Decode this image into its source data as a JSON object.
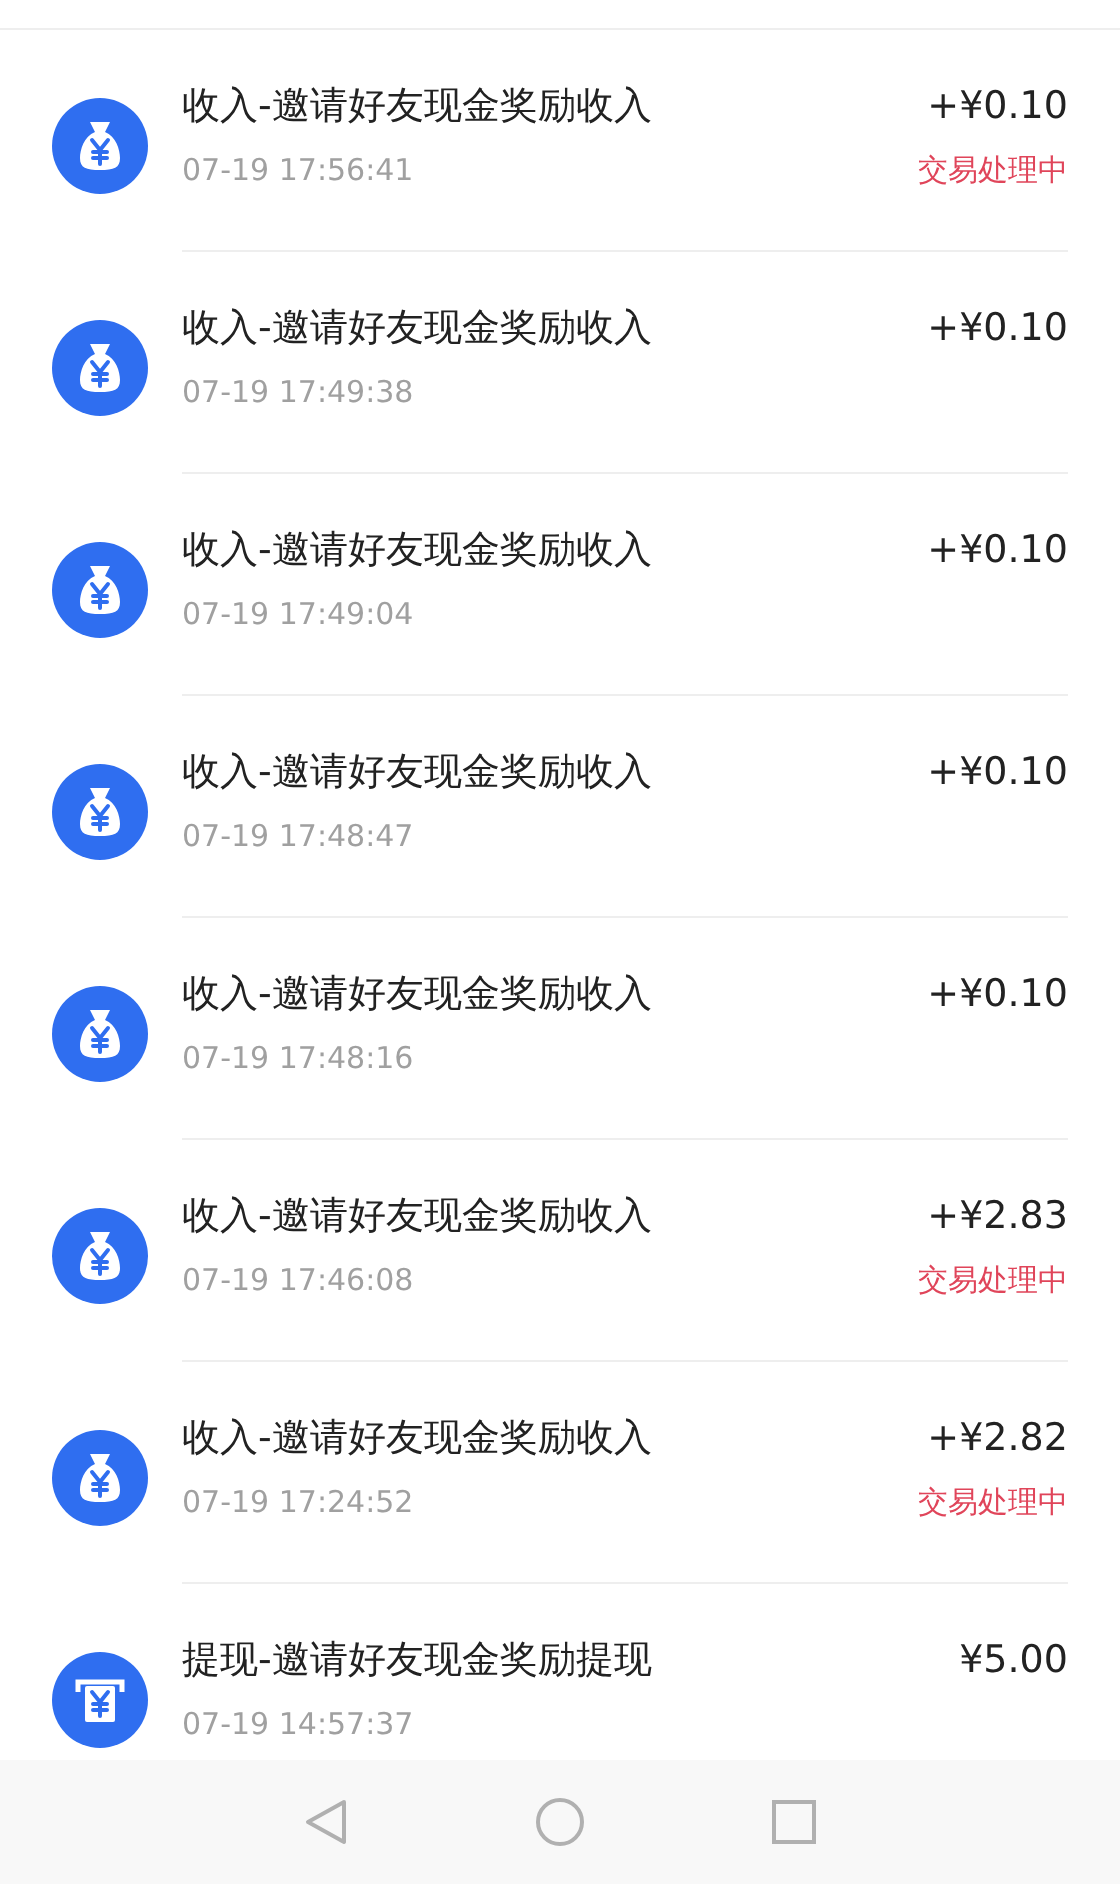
{
  "transactions": [
    {
      "kind": "income",
      "title": "收入-邀请好友现金奖励收入",
      "time": "07-19 17:56:41",
      "amount": "+¥0.10",
      "status": "交易处理中"
    },
    {
      "kind": "income",
      "title": "收入-邀请好友现金奖励收入",
      "time": "07-19 17:49:38",
      "amount": "+¥0.10"
    },
    {
      "kind": "income",
      "title": "收入-邀请好友现金奖励收入",
      "time": "07-19 17:49:04",
      "amount": "+¥0.10"
    },
    {
      "kind": "income",
      "title": "收入-邀请好友现金奖励收入",
      "time": "07-19 17:48:47",
      "amount": "+¥0.10"
    },
    {
      "kind": "income",
      "title": "收入-邀请好友现金奖励收入",
      "time": "07-19 17:48:16",
      "amount": "+¥0.10"
    },
    {
      "kind": "income",
      "title": "收入-邀请好友现金奖励收入",
      "time": "07-19 17:46:08",
      "amount": "+¥2.83",
      "status": "交易处理中"
    },
    {
      "kind": "income",
      "title": "收入-邀请好友现金奖励收入",
      "time": "07-19 17:24:52",
      "amount": "+¥2.82",
      "status": "交易处理中"
    },
    {
      "kind": "withdrawal",
      "title": "提现-邀请好友现金奖励提现",
      "time": "07-19 14:57:37",
      "amount": "¥5.00"
    }
  ]
}
